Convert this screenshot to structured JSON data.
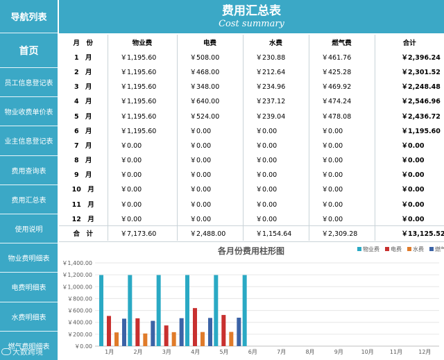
{
  "sidebar": {
    "title": "导航列表",
    "home": "首页",
    "items": [
      "员工信息登记表",
      "物业收费单价表",
      "业主信息登记表",
      "费用查询表",
      "费用汇总表",
      "使用说明",
      "物业费明细表",
      "电费明细表",
      "水费明细表",
      "燃气费明细表"
    ]
  },
  "header": {
    "title": "费用汇总表",
    "subtitle": "Cost summary"
  },
  "table": {
    "columns": [
      "月　份",
      "物业费",
      "电费",
      "水费",
      "燃气费",
      "合计"
    ],
    "rows": [
      {
        "month": "1　月",
        "wy": "￥1,195.60",
        "df": "￥508.00",
        "sf": "￥230.88",
        "rq": "￥461.76",
        "hj": "￥2,396.24"
      },
      {
        "month": "2　月",
        "wy": "￥1,195.60",
        "df": "￥468.00",
        "sf": "￥212.64",
        "rq": "￥425.28",
        "hj": "￥2,301.52"
      },
      {
        "month": "3　月",
        "wy": "￥1,195.60",
        "df": "￥348.00",
        "sf": "￥234.96",
        "rq": "￥469.92",
        "hj": "￥2,248.48"
      },
      {
        "month": "4　月",
        "wy": "￥1,195.60",
        "df": "￥640.00",
        "sf": "￥237.12",
        "rq": "￥474.24",
        "hj": "￥2,546.96"
      },
      {
        "month": "5　月",
        "wy": "￥1,195.60",
        "df": "￥524.00",
        "sf": "￥239.04",
        "rq": "￥478.08",
        "hj": "￥2,436.72"
      },
      {
        "month": "6　月",
        "wy": "￥1,195.60",
        "df": "￥0.00",
        "sf": "￥0.00",
        "rq": "￥0.00",
        "hj": "￥1,195.60"
      },
      {
        "month": "7　月",
        "wy": "￥0.00",
        "df": "￥0.00",
        "sf": "￥0.00",
        "rq": "￥0.00",
        "hj": "￥0.00"
      },
      {
        "month": "8　月",
        "wy": "￥0.00",
        "df": "￥0.00",
        "sf": "￥0.00",
        "rq": "￥0.00",
        "hj": "￥0.00"
      },
      {
        "month": "9　月",
        "wy": "￥0.00",
        "df": "￥0.00",
        "sf": "￥0.00",
        "rq": "￥0.00",
        "hj": "￥0.00"
      },
      {
        "month": "10　月",
        "wy": "￥0.00",
        "df": "￥0.00",
        "sf": "￥0.00",
        "rq": "￥0.00",
        "hj": "￥0.00"
      },
      {
        "month": "11　月",
        "wy": "￥0.00",
        "df": "￥0.00",
        "sf": "￥0.00",
        "rq": "￥0.00",
        "hj": "￥0.00"
      },
      {
        "month": "12　月",
        "wy": "￥0.00",
        "df": "￥0.00",
        "sf": "￥0.00",
        "rq": "￥0.00",
        "hj": "￥0.00"
      }
    ],
    "total": {
      "month": "合　计",
      "wy": "￥7,173.60",
      "df": "￥2,488.00",
      "sf": "￥1,154.64",
      "rq": "￥2,309.28",
      "hj": "￥13,125.52"
    }
  },
  "chart_data": {
    "type": "bar",
    "title": "各月份费用柱形图",
    "categories": [
      "1月",
      "2月",
      "3月",
      "4月",
      "5月",
      "6月",
      "7月",
      "8月",
      "9月",
      "10月",
      "11月",
      "12月"
    ],
    "series": [
      {
        "name": "物业费",
        "color": "#2aa9c4",
        "values": [
          1195.6,
          1195.6,
          1195.6,
          1195.6,
          1195.6,
          1195.6,
          0,
          0,
          0,
          0,
          0,
          0
        ]
      },
      {
        "name": "电费",
        "color": "#c8302f",
        "values": [
          508,
          468,
          348,
          640,
          524,
          0,
          0,
          0,
          0,
          0,
          0,
          0
        ]
      },
      {
        "name": "水费",
        "color": "#e07b2a",
        "values": [
          230.88,
          212.64,
          234.96,
          237.12,
          239.04,
          0,
          0,
          0,
          0,
          0,
          0,
          0
        ]
      },
      {
        "name": "燃气费",
        "color": "#3b63a6",
        "values": [
          461.76,
          425.28,
          469.92,
          474.24,
          478.08,
          0,
          0,
          0,
          0,
          0,
          0,
          0
        ]
      }
    ],
    "yticks": [
      "￥0.00",
      "￥200.00",
      "￥400.00",
      "￥600.00",
      "￥800.00",
      "￥1,000.00",
      "￥1,200.00",
      "￥1,400.00"
    ],
    "ylim": [
      0,
      1400
    ],
    "legend": "top-right"
  },
  "watermark": "大数跨境"
}
